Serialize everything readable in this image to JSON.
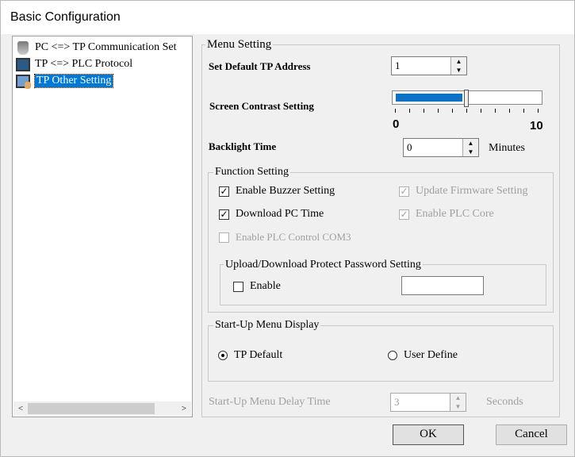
{
  "window": {
    "title": "Basic Configuration"
  },
  "tree": {
    "items": [
      {
        "label": "PC <=> TP Communication Set",
        "icon": "pc-connection-icon"
      },
      {
        "label": "TP <=> PLC Protocol",
        "icon": "plc-protocol-icon"
      },
      {
        "label": "TP Other Setting",
        "icon": "touch-screen-icon",
        "selected": true
      }
    ]
  },
  "menu_setting": {
    "title": "Menu Setting",
    "tp_address": {
      "label": "Set Default TP Address",
      "value": "1"
    },
    "contrast": {
      "label": "Screen Contrast Setting",
      "min_label": "0",
      "max_label": "10",
      "value": 5,
      "min": 0,
      "max": 10
    },
    "backlight": {
      "label": "Backlight Time",
      "value": "0",
      "unit": "Minutes"
    },
    "function": {
      "title": "Function Setting",
      "buzzer": {
        "label": "Enable Buzzer Setting",
        "checked": true
      },
      "download_time": {
        "label": "Download PC Time",
        "checked": true
      },
      "update_fw": {
        "label": "Update Firmware Setting",
        "checked": true,
        "disabled": true
      },
      "plc_core": {
        "label": "Enable PLC Core",
        "checked": true,
        "disabled": true
      },
      "plc_com3": {
        "label": "Enable PLC Control COM3",
        "checked": false,
        "disabled": true
      },
      "password": {
        "title": "Upload/Download Protect Password Setting",
        "enable_label": "Enable",
        "value": ""
      }
    },
    "startup": {
      "title": "Start-Up Menu Display",
      "tp_default": "TP Default",
      "user_define": "User Define",
      "selected": "tp_default"
    },
    "delay": {
      "label": "Start-Up Menu Delay Time",
      "value": "3",
      "unit": "Seconds"
    }
  },
  "buttons": {
    "ok": "OK",
    "cancel": "Cancel"
  }
}
